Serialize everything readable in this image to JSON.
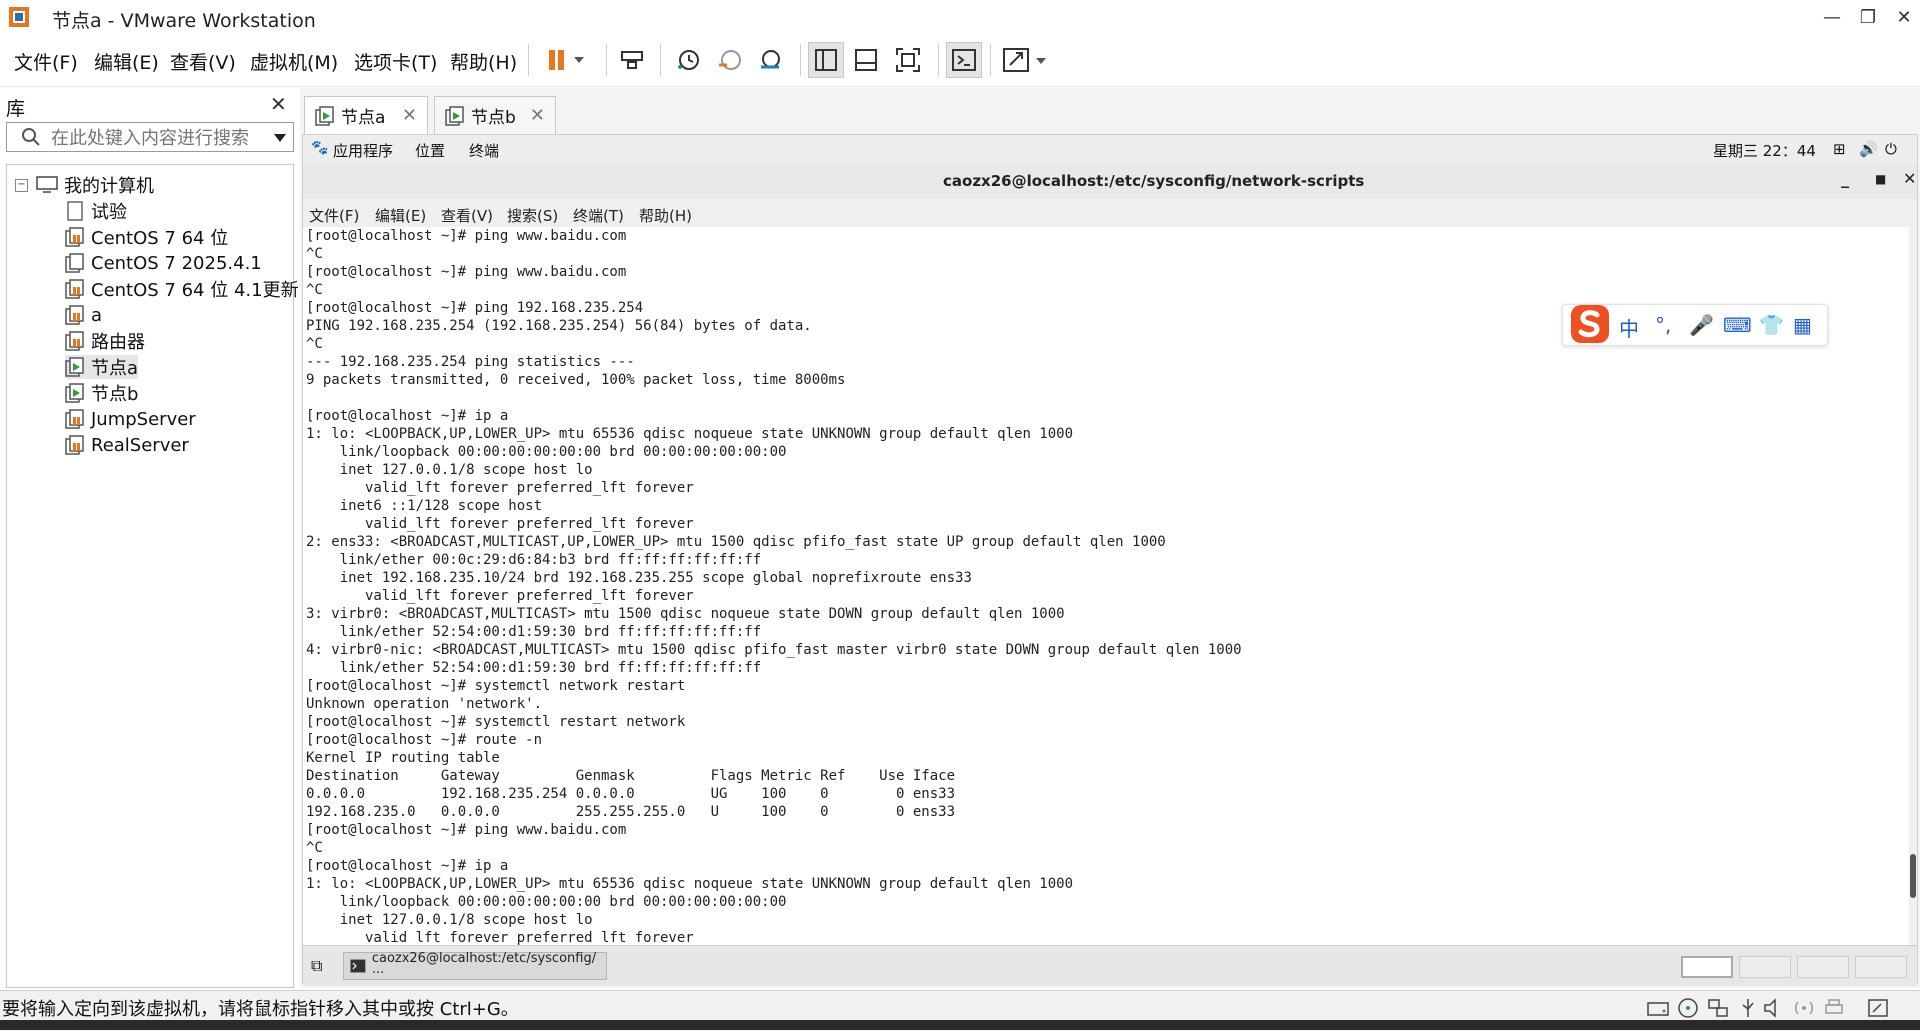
{
  "window": {
    "title": "节点a - VMware Workstation"
  },
  "menu": [
    "文件(F)",
    "编辑(E)",
    "查看(V)",
    "虚拟机(M)",
    "选项卡(T)",
    "帮助(H)"
  ],
  "library": {
    "title": "库",
    "search_placeholder": "在此处键入内容进行搜索",
    "root": "我的计算机",
    "items": [
      "试验",
      "CentOS 7 64 位",
      "CentOS 7 2025.4.1",
      "CentOS 7 64 位 4.1更新",
      "a",
      "路由器",
      "节点a",
      "节点b",
      "JumpServer",
      "RealServer"
    ]
  },
  "tabs": [
    {
      "label": "节点a",
      "active": true
    },
    {
      "label": "节点b",
      "active": false
    }
  ],
  "guest": {
    "top_menu": [
      "应用程序",
      "位置",
      "终端"
    ],
    "clock": "星期三 22：44",
    "terminal": {
      "title": "caozx26@localhost:/etc/sysconfig/network-scripts",
      "menu": [
        "文件(F)",
        "编辑(E)",
        "查看(V)",
        "搜索(S)",
        "终端(T)",
        "帮助(H)"
      ],
      "lines": [
        "[root@localhost ~]# ping www.baidu.com",
        "^C",
        "[root@localhost ~]# ping www.baidu.com",
        "^C",
        "[root@localhost ~]# ping 192.168.235.254",
        "PING 192.168.235.254 (192.168.235.254) 56(84) bytes of data.",
        "^C",
        "--- 192.168.235.254 ping statistics ---",
        "9 packets transmitted, 0 received, 100% packet loss, time 8000ms",
        "",
        "[root@localhost ~]# ip a",
        "1: lo: <LOOPBACK,UP,LOWER_UP> mtu 65536 qdisc noqueue state UNKNOWN group default qlen 1000",
        "    link/loopback 00:00:00:00:00:00 brd 00:00:00:00:00:00",
        "    inet 127.0.0.1/8 scope host lo",
        "       valid_lft forever preferred_lft forever",
        "    inet6 ::1/128 scope host",
        "       valid_lft forever preferred_lft forever",
        "2: ens33: <BROADCAST,MULTICAST,UP,LOWER_UP> mtu 1500 qdisc pfifo_fast state UP group default qlen 1000",
        "    link/ether 00:0c:29:d6:84:b3 brd ff:ff:ff:ff:ff:ff",
        "    inet 192.168.235.10/24 brd 192.168.235.255 scope global noprefixroute ens33",
        "       valid_lft forever preferred_lft forever",
        "3: virbr0: <BROADCAST,MULTICAST> mtu 1500 qdisc noqueue state DOWN group default qlen 1000",
        "    link/ether 52:54:00:d1:59:30 brd ff:ff:ff:ff:ff:ff",
        "4: virbr0-nic: <BROADCAST,MULTICAST> mtu 1500 qdisc pfifo_fast master virbr0 state DOWN group default qlen 1000",
        "    link/ether 52:54:00:d1:59:30 brd ff:ff:ff:ff:ff:ff",
        "[root@localhost ~]# systemctl network restart",
        "Unknown operation 'network'.",
        "[root@localhost ~]# systemctl restart network",
        "[root@localhost ~]# route -n",
        "Kernel IP routing table",
        "Destination     Gateway         Genmask         Flags Metric Ref    Use Iface",
        "0.0.0.0         192.168.235.254 0.0.0.0         UG    100    0        0 ens33",
        "192.168.235.0   0.0.0.0         255.255.255.0   U     100    0        0 ens33",
        "[root@localhost ~]# ping www.baidu.com",
        "^C",
        "[root@localhost ~]# ip a",
        "1: lo: <LOOPBACK,UP,LOWER_UP> mtu 65536 qdisc noqueue state UNKNOWN group default qlen 1000",
        "    link/loopback 00:00:00:00:00:00 brd 00:00:00:00:00:00",
        "    inet 127.0.0.1/8 scope host lo",
        "       valid_lft forever preferred_lft forever"
      ]
    },
    "taskbar_item": "caozx26@localhost:/etc/sysconfig/···"
  },
  "ime": {
    "lang": "中",
    "punct": "°,"
  },
  "statusbar": {
    "message": "要将输入定向到该虚拟机，请将鼠标指针移入其中或按 Ctrl+G。"
  },
  "colors": {
    "accent_orange": "#e8771b",
    "vm_green": "#2e9d3a",
    "ime_red": "#f04e23",
    "ime_blue": "#1e5fd6"
  }
}
